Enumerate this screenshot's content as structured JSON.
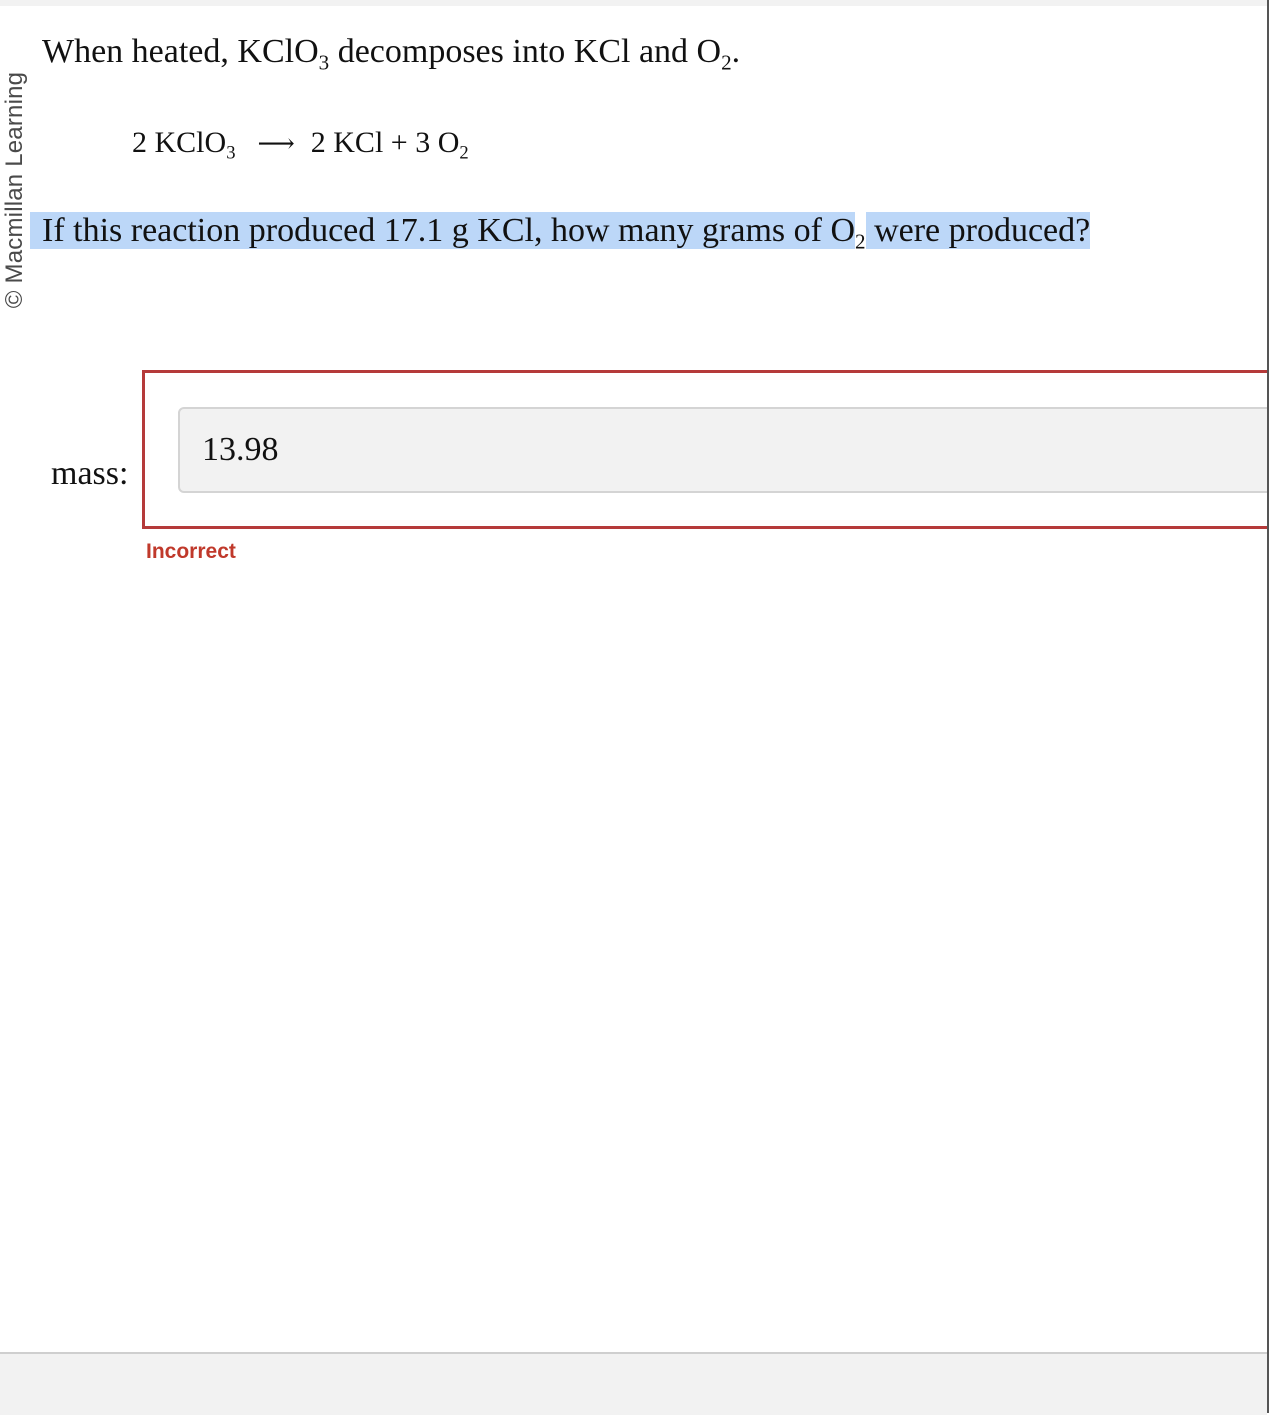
{
  "copyright": "© Macmillan Learning",
  "intro": {
    "part1": "When heated, KClO",
    "sub1": "3",
    "part2": " decomposes into KCl and O",
    "sub2": "2",
    "part3": "."
  },
  "equation": {
    "lhs": "2 KClO",
    "lhs_sub": "3",
    "arrow": "⟶",
    "rhs": "2 KCl + 3 O",
    "rhs_sub": "2"
  },
  "question": {
    "part1": "If this reaction produced ",
    "part2": "17.1 g KCl",
    "part3": ", how many grams of O",
    "sub": "2",
    "part4": " were produced?"
  },
  "answer": {
    "label": "mass:",
    "value": "13.98",
    "status": "Incorrect"
  },
  "colors": {
    "error": "#b53a3a",
    "selection": "#bcd7f8"
  }
}
